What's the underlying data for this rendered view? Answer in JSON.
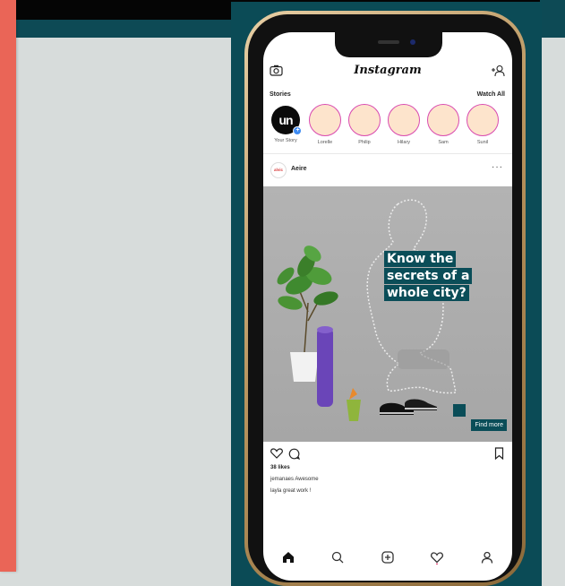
{
  "app": {
    "logo": "Instagram"
  },
  "stories": {
    "label": "Stories",
    "watch_all": "Watch All",
    "your_story": {
      "avatar_text": "un",
      "name": "Your Story",
      "badge": "+"
    },
    "items": [
      {
        "name": "Lorelle"
      },
      {
        "name": "Philip"
      },
      {
        "name": "Hilary"
      },
      {
        "name": "Sam"
      },
      {
        "name": "Sunil"
      }
    ]
  },
  "post": {
    "avatar_text": "alvic",
    "user": "Aeire",
    "more": "···",
    "headline": [
      "Know the",
      "secrets of a",
      "whole city?"
    ],
    "cta": "Find more",
    "likes": "38 likes",
    "comments": [
      "jemanaes Awesome",
      "layla great work !"
    ]
  },
  "icons": {
    "camera": "camera-icon",
    "add_user": "add-user-icon",
    "heart": "heart-icon",
    "comment": "comment-icon",
    "bookmark": "bookmark-icon",
    "home": "home-icon",
    "search": "search-icon",
    "new_post": "new-post-icon",
    "activity": "activity-heart-icon",
    "profile": "profile-icon"
  },
  "colors": {
    "teal": "#0b4b56",
    "coral": "#ea6557",
    "story_ring": "#d94bb0",
    "story_fill": "#fde4cc"
  }
}
